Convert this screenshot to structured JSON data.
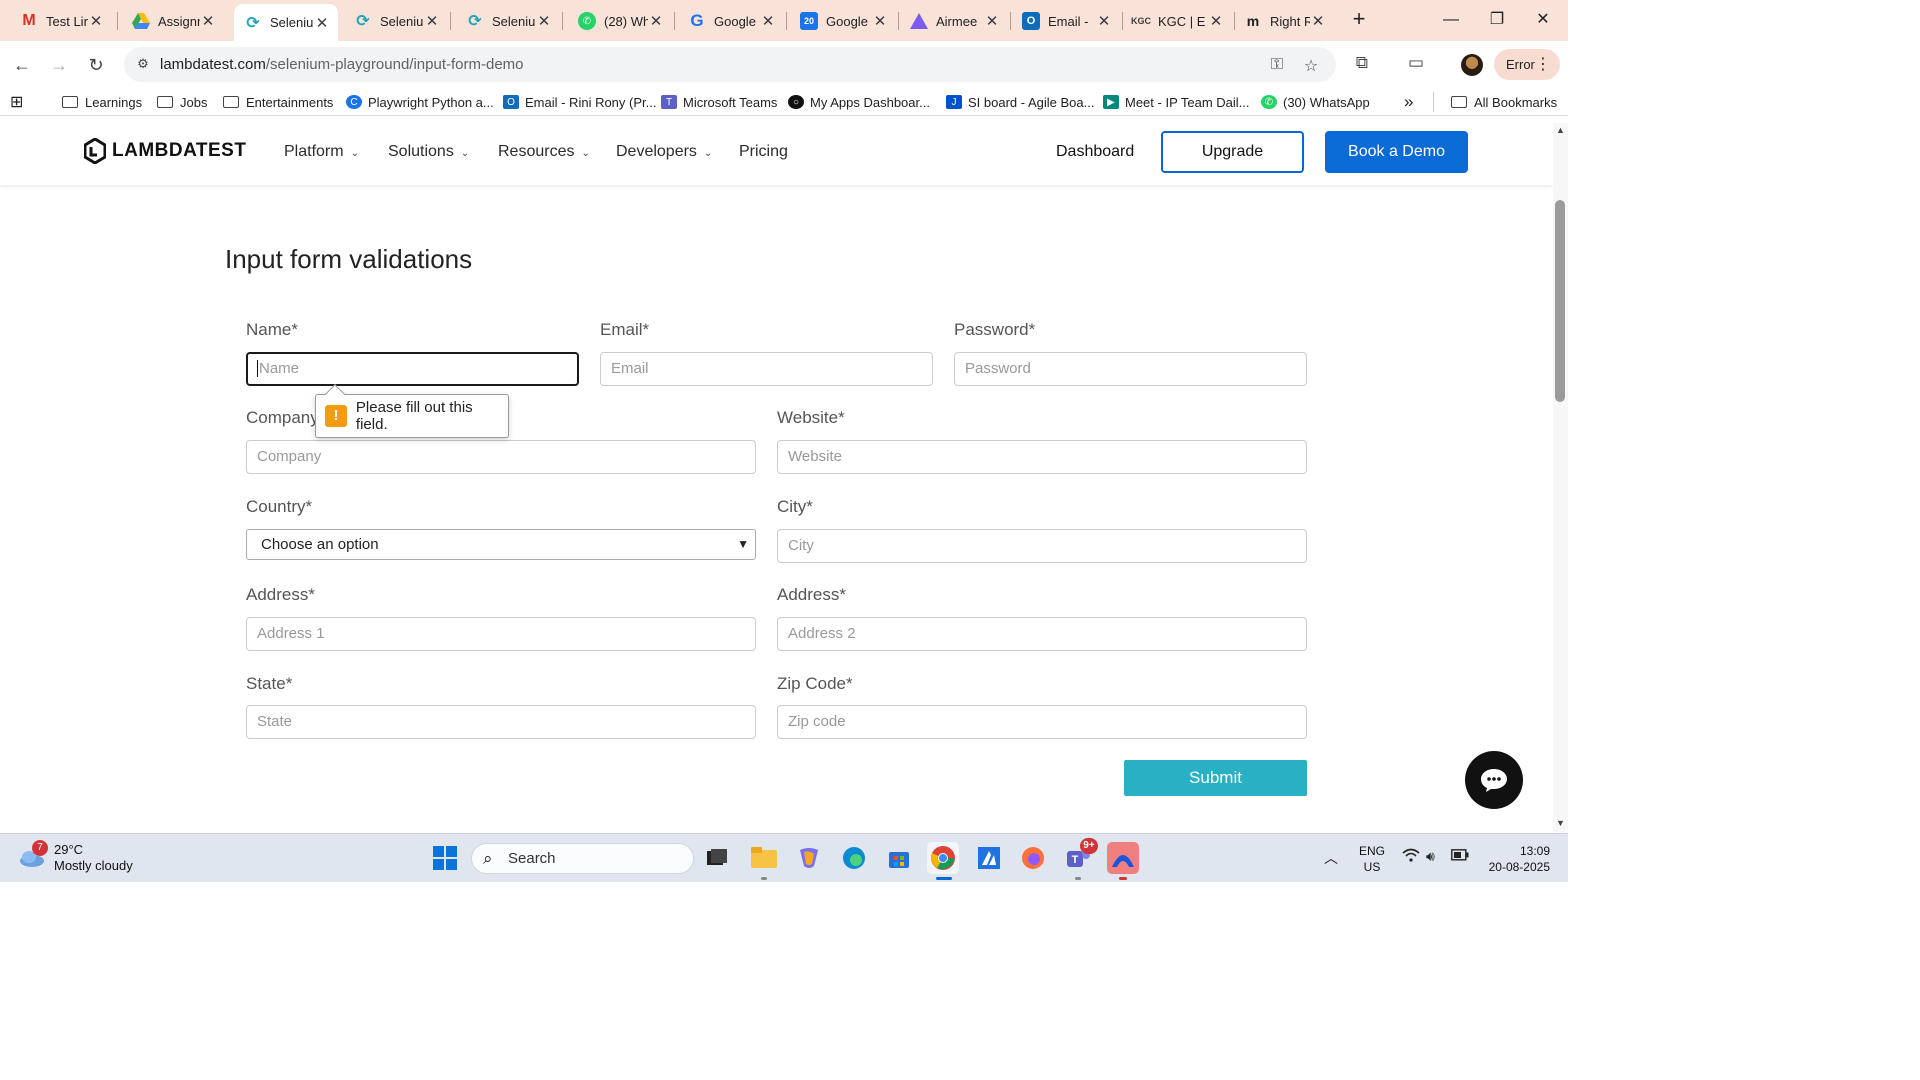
{
  "browser": {
    "tabs": [
      {
        "title": "Test Lin",
        "icon": "gmail-icon",
        "color": "#d93025"
      },
      {
        "title": "Assignm",
        "icon": "drive-icon",
        "color": "#1a73e8"
      },
      {
        "title": "Seleniu",
        "icon": "lambdatest-icon",
        "color": "#1fa3b8",
        "active": true
      },
      {
        "title": "Seleniu",
        "icon": "lambdatest-icon",
        "color": "#1fa3b8"
      },
      {
        "title": "Seleniu",
        "icon": "lambdatest-icon",
        "color": "#1fa3b8"
      },
      {
        "title": "(28) Wh",
        "icon": "whatsapp-icon",
        "color": "#25d366"
      },
      {
        "title": "Google",
        "icon": "google-icon",
        "color": "#1a73e8"
      },
      {
        "title": "Google",
        "icon": "calendar-icon",
        "color": "#1a73e8"
      },
      {
        "title": "Airmee",
        "icon": "airmeet-icon",
        "color": "#7b5cf0"
      },
      {
        "title": "Email -",
        "icon": "outlook-icon",
        "color": "#0f6cbd"
      },
      {
        "title": "KGC | E",
        "icon": "kgc-icon",
        "color": "#8a2be2"
      },
      {
        "title": "Right R",
        "icon": "rr-icon",
        "color": "#333333"
      }
    ],
    "url_host": "lambdatest.com",
    "url_path": "/selenium-playground/input-form-demo",
    "profile_status": "Error"
  },
  "bookmarks": [
    {
      "label": "Learnings",
      "type": "folder"
    },
    {
      "label": "Jobs",
      "type": "folder"
    },
    {
      "label": "Entertainments",
      "type": "folder"
    },
    {
      "label": "Playwright Python a...",
      "type": "link",
      "color": "#1a73e8"
    },
    {
      "label": "Email - Rini Rony (Pr...",
      "type": "link",
      "color": "#0f6cbd"
    },
    {
      "label": "Microsoft Teams",
      "type": "link",
      "color": "#5b5fc7"
    },
    {
      "label": "My Apps Dashboar...",
      "type": "link",
      "color": "#111111"
    },
    {
      "label": "SI board - Agile Boa...",
      "type": "link",
      "color": "#0052cc"
    },
    {
      "label": "Meet - IP Team Dail...",
      "type": "link",
      "color": "#00897b"
    },
    {
      "label": "(30) WhatsApp",
      "type": "link",
      "color": "#25d366"
    }
  ],
  "bookmarks_overflow": "»",
  "all_bookmarks": "All Bookmarks",
  "site": {
    "logo": "LAMBDATEST",
    "nav": [
      "Platform",
      "Solutions",
      "Resources",
      "Developers",
      "Pricing"
    ],
    "dashboard": "Dashboard",
    "upgrade": "Upgrade",
    "book_demo": "Book a Demo"
  },
  "form": {
    "title": "Input form validations",
    "name_label": "Name*",
    "name_placeholder": "Name",
    "email_label": "Email*",
    "email_placeholder": "Email",
    "password_label": "Password*",
    "password_placeholder": "Password",
    "company_label": "Company*",
    "company_placeholder": "Company",
    "website_label": "Website*",
    "website_placeholder": "Website",
    "country_label": "Country*",
    "country_selected": "Choose an option",
    "city_label": "City*",
    "city_placeholder": "City",
    "address1_label": "Address*",
    "address1_placeholder": "Address 1",
    "address2_label": "Address*",
    "address2_placeholder": "Address 2",
    "state_label": "State*",
    "state_placeholder": "State",
    "zip_label": "Zip Code*",
    "zip_placeholder": "Zip code",
    "submit": "Submit",
    "validation_message": "Please fill out this field."
  },
  "taskbar": {
    "weather_temp": "29°C",
    "weather_desc": "Mostly cloudy",
    "weather_badge": "7",
    "search": "Search",
    "teams_badge": "9+",
    "lang_1": "ENG",
    "lang_2": "US",
    "time": "13:09",
    "date": "20-08-2025"
  }
}
